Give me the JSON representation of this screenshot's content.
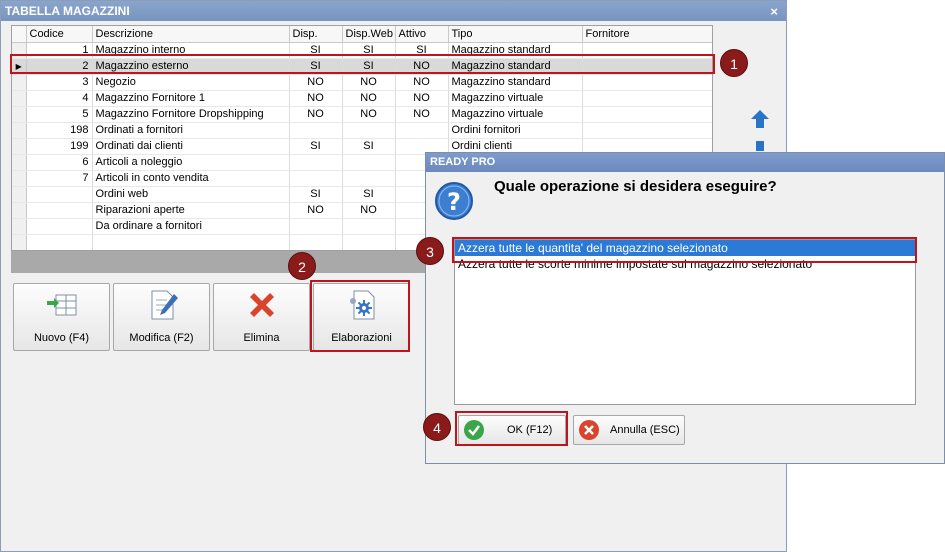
{
  "window": {
    "title": "TABELLA MAGAZZINI",
    "close_label": "×"
  },
  "grid": {
    "columns": [
      "Codice",
      "Descrizione",
      "Disp.",
      "Disp.Web",
      "Attivo",
      "Tipo",
      "Fornitore"
    ],
    "rows": [
      {
        "codice": "1",
        "descrizione": "Magazzino interno",
        "disp": "SI",
        "disp_web": "SI",
        "attivo": "SI",
        "tipo": "Magazzino standard",
        "fornitore": ""
      },
      {
        "codice": "2",
        "descrizione": "Magazzino esterno",
        "disp": "SI",
        "disp_web": "SI",
        "attivo": "NO",
        "tipo": "Magazzino standard",
        "fornitore": "",
        "selected": true
      },
      {
        "codice": "3",
        "descrizione": "Negozio",
        "disp": "NO",
        "disp_web": "NO",
        "attivo": "NO",
        "tipo": "Magazzino standard",
        "fornitore": ""
      },
      {
        "codice": "4",
        "descrizione": "Magazzino Fornitore 1",
        "disp": "NO",
        "disp_web": "NO",
        "attivo": "NO",
        "tipo": "Magazzino virtuale",
        "fornitore": ""
      },
      {
        "codice": "5",
        "descrizione": "Magazzino Fornitore Dropshipping",
        "disp": "NO",
        "disp_web": "NO",
        "attivo": "NO",
        "tipo": "Magazzino virtuale",
        "fornitore": ""
      },
      {
        "codice": "198",
        "descrizione": "Ordinati a fornitori",
        "disp": "",
        "disp_web": "",
        "attivo": "",
        "tipo": "Ordini fornitori",
        "fornitore": ""
      },
      {
        "codice": "199",
        "descrizione": "Ordinati dai clienti",
        "disp": "SI",
        "disp_web": "SI",
        "attivo": "",
        "tipo": "Ordini clienti",
        "fornitore": ""
      },
      {
        "codice": "6",
        "descrizione": "Articoli a noleggio",
        "disp": "",
        "disp_web": "",
        "attivo": "",
        "tipo": "",
        "fornitore": ""
      },
      {
        "codice": "7",
        "descrizione": "Articoli in conto vendita",
        "disp": "",
        "disp_web": "",
        "attivo": "",
        "tipo": "",
        "fornitore": ""
      },
      {
        "codice": "",
        "descrizione": "Ordini web",
        "disp": "SI",
        "disp_web": "SI",
        "attivo": "",
        "tipo": "",
        "fornitore": ""
      },
      {
        "codice": "",
        "descrizione": "Riparazioni aperte",
        "disp": "NO",
        "disp_web": "NO",
        "attivo": "",
        "tipo": "",
        "fornitore": ""
      },
      {
        "codice": "",
        "descrizione": "Da ordinare a fornitori",
        "disp": "",
        "disp_web": "",
        "attivo": "",
        "tipo": "",
        "fornitore": ""
      },
      {
        "codice": "",
        "descrizione": "",
        "disp": "",
        "disp_web": "",
        "attivo": "",
        "tipo": "",
        "fornitore": ""
      }
    ]
  },
  "toolbar": {
    "new_label": "Nuovo (F4)",
    "edit_label": "Modifica (F2)",
    "delete_label": "Elimina",
    "process_label": "Elaborazioni"
  },
  "dialog": {
    "title": "READY PRO",
    "question": "Quale operazione si desidera eseguire?",
    "options": [
      "Azzera tutte le quantita' del magazzino selezionato",
      "Azzera tutte le scorte minime impostate sul magazzino selezionato"
    ],
    "selected_option": 0,
    "ok_label": "OK (F12)",
    "cancel_label": "Annulla (ESC)"
  },
  "badges": [
    "1",
    "2",
    "3",
    "4"
  ],
  "colors": {
    "highlight": "#c0141c",
    "badge": "#8b1a1a",
    "selection": "#2a7ad6",
    "title_bar": "#7f9ccd"
  },
  "icons": [
    "selected-row-arrow-icon",
    "move-up-icon",
    "move-down-icon",
    "new-table-icon",
    "edit-document-icon",
    "delete-x-icon",
    "process-gear-icon",
    "question-icon",
    "ok-check-icon",
    "cancel-x-icon"
  ]
}
